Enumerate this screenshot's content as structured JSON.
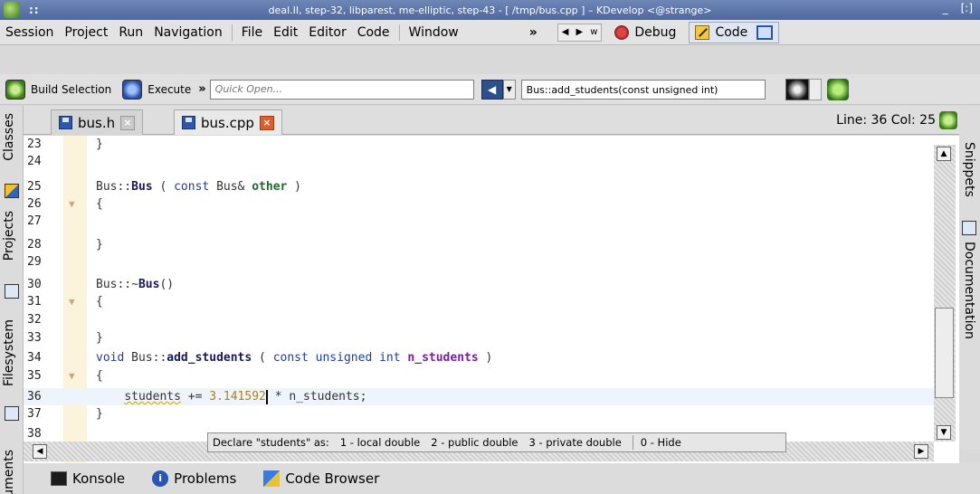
{
  "window": {
    "title": "deal.II, step-32, libparest, me-elliptic, step-43 - [ /tmp/bus.cpp ] – KDevelop <@strange>",
    "minimize": "_",
    "maximize": "[:]"
  },
  "menu": {
    "session": "Session",
    "project": "Project",
    "run": "Run",
    "navigation": "Navigation",
    "file": "File",
    "edit": "Edit",
    "editor": "Editor",
    "code": "Code",
    "window": "Window",
    "overflow": "»",
    "w_label": "w",
    "debug": "Debug",
    "code_area": "Code"
  },
  "toolbar": {
    "build_selection": "Build Selection",
    "execute": "Execute",
    "overflow": "»",
    "quick_open_placeholder": "Quick Open...",
    "context": "Bus::add_students(const unsigned int)"
  },
  "tabs": [
    {
      "label": "bus.h",
      "active": false
    },
    {
      "label": "bus.cpp",
      "active": true
    }
  ],
  "status": {
    "line_col": "Line: 36 Col: 25"
  },
  "left_dock": {
    "classes": "Classes",
    "projects": "Projects",
    "filesystem": "Filesystem",
    "documents": "uments"
  },
  "right_dock": {
    "snippets": "Snippets",
    "documentation": "Documentation"
  },
  "code": {
    "lines": [
      {
        "n": "23",
        "text": "}"
      },
      {
        "n": "24",
        "text": ""
      },
      {
        "n": "25",
        "text": "Bus::Bus ( const Bus& other )"
      },
      {
        "n": "26",
        "text": "{"
      },
      {
        "n": "27",
        "text": ""
      },
      {
        "n": "28",
        "text": "}"
      },
      {
        "n": "29",
        "text": ""
      },
      {
        "n": "30",
        "text": "Bus::~Bus()"
      },
      {
        "n": "31",
        "text": "{"
      },
      {
        "n": "32",
        "text": ""
      },
      {
        "n": "33",
        "text": "}"
      },
      {
        "n": "34",
        "text": "void Bus::add_students ( const unsigned int n_students )"
      },
      {
        "n": "35",
        "text": "{"
      },
      {
        "n": "36",
        "text": "    students += 3.141592 * n_students;"
      },
      {
        "n": "37",
        "text": "}"
      },
      {
        "n": "38",
        "text": ""
      }
    ],
    "tokens": {
      "bus_ns": "Bus::",
      "bus_ctor": "Bus",
      "const": "const",
      "bus_ref": "Bus&",
      "other": "other",
      "dtor": "Bus::~",
      "dtor_name": "Bus",
      "void": "void",
      "method": "add_students",
      "unsigned": "unsigned",
      "int": "int",
      "param": "n_students",
      "students": "students",
      "op": "+=",
      "number": "3.141592",
      "rest": "* n_students;"
    }
  },
  "assistant": {
    "prompt": "Declare \"students\" as:",
    "opt1": "1 - local double",
    "opt2": "2 - public double",
    "opt3": "3 - private double",
    "hide": "0 - Hide"
  },
  "bottom": {
    "konsole": "Konsole",
    "problems": "Problems",
    "code_browser": "Code Browser"
  }
}
